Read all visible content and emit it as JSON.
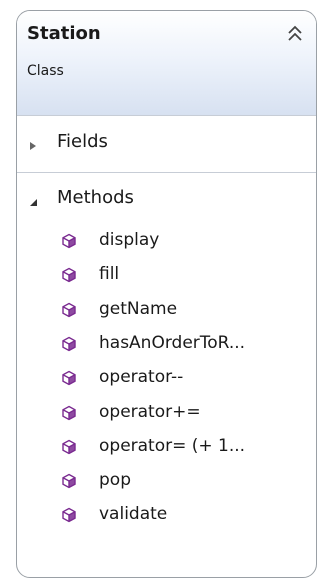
{
  "class_box": {
    "title": "Station",
    "subtitle": "Class"
  },
  "sections": {
    "fields": {
      "label": "Fields",
      "expanded": false
    },
    "methods": {
      "label": "Methods",
      "expanded": true
    }
  },
  "methods": [
    "display",
    "fill",
    "getName",
    "hasAnOrderToR...",
    "operator--",
    "operator+=",
    "operator= (+ 1...",
    "pop",
    "validate"
  ],
  "colors": {
    "method_icon": "#7a2a90",
    "header_gradient_end": "#d7e1f1",
    "border": "#9aa0a6"
  },
  "icons": {
    "collapse": "double-chevron-up-icon",
    "fields_toggle": "triangle-right-icon",
    "methods_toggle": "triangle-down-icon",
    "method": "method-cube-icon"
  }
}
